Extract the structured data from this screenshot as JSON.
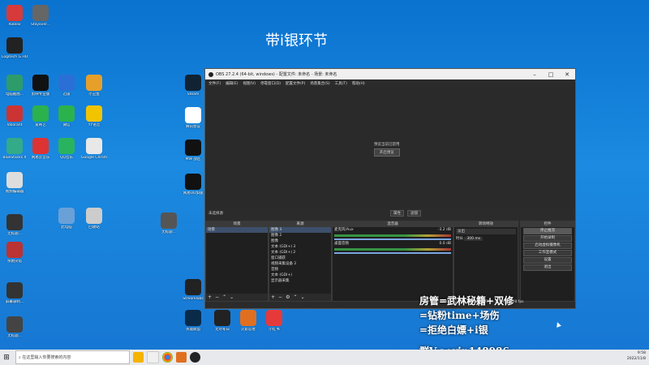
{
  "overlay_title": "带i银环节",
  "desktop_icons": [
    {
      "label": "Roblox",
      "color": "#d63a3a"
    },
    {
      "label": "Stayover...",
      "color": "#666"
    },
    {
      "label": "Logitech G HUB",
      "color": "#222"
    },
    {
      "label": "电脑截图...",
      "color": "#2d9c6a"
    },
    {
      "label": "剪映专业版",
      "color": "#111"
    },
    {
      "label": "迅雷",
      "color": "#2a6fd6"
    },
    {
      "label": "小丑鱼",
      "color": "#e6a02a"
    },
    {
      "label": "Valorant",
      "color": "#c33"
    },
    {
      "label": "爱奇艺",
      "color": "#2bb24c"
    },
    {
      "label": "微信",
      "color": "#2bb24c"
    },
    {
      "label": "YY语音",
      "color": "#f2c400"
    },
    {
      "label": "BlueStacks X",
      "color": "#3a8"
    },
    {
      "label": "网易云音乐",
      "color": "#d33"
    },
    {
      "label": "QQ音乐",
      "color": "#29b35f"
    },
    {
      "label": "Google Chrome",
      "color": "#e8e8e8"
    },
    {
      "label": "视频编辑器",
      "color": "#ddd"
    },
    {
      "label": "此电脑",
      "color": "#6aa0d8"
    },
    {
      "label": "回收站",
      "color": "#ccc"
    },
    {
      "label": "无标题...",
      "color": "#333"
    },
    {
      "label": "杀戮尖塔",
      "color": "#b33"
    },
    {
      "label": "屏幕录制...",
      "color": "#333"
    },
    {
      "label": "无标题...",
      "color": "#444"
    },
    {
      "label": "无标题...",
      "color": "#555"
    },
    {
      "label": "Steam",
      "color": "#123"
    },
    {
      "label": "腾讯会议",
      "color": "#fff"
    },
    {
      "label": "MW 战区",
      "color": "#111"
    },
    {
      "label": "网易UU加速",
      "color": "#111"
    },
    {
      "label": "Streamlabs",
      "color": "#222"
    },
    {
      "label": "英雄联盟",
      "color": "#0a2a4a"
    },
    {
      "label": "无尽冬日",
      "color": "#222"
    },
    {
      "label": "火影忍者",
      "color": "#e07020"
    },
    {
      "label": "小红书",
      "color": "#e63a3a"
    }
  ],
  "obs": {
    "title": "OBS 27.2.4 (64-bit, windows) - 配置文件: 未命名 - 场景: 未命名",
    "menu": [
      "文件(F)",
      "编辑(E)",
      "视图(V)",
      "停靠窗口(D)",
      "配置文件(P)",
      "场景集合(S)",
      "工具(T)",
      "帮助(H)"
    ],
    "preview_msg": "预览当前已禁用",
    "preview_btn": "开启预览",
    "source_bar": {
      "no_source": "未选择源",
      "props": "属性",
      "filters": "滤镜"
    },
    "scenes": {
      "header": "场景",
      "items": [
        "场景"
      ]
    },
    "sources": {
      "header": "来源",
      "items": [
        "图像 3",
        "图像 2",
        "图像",
        "文本 (GDI+) 3",
        "文本 (GDI+) 2",
        "窗口捕获",
        "视频采集设备 2",
        "音频",
        "文本 (GDI+)",
        "显示器采集"
      ]
    },
    "mixer": {
      "header": "混音器",
      "tracks": [
        {
          "name": "麦克风/Aux",
          "db": "-3.2 dB"
        },
        {
          "name": "桌面音频",
          "db": "0.0 dB"
        }
      ]
    },
    "transitions": {
      "header": "转场特效",
      "type": "淡出",
      "duration_label": "时长",
      "duration": "300 ms"
    },
    "controls": {
      "header": "控件",
      "buttons": [
        "停止推流",
        "开始录制",
        "启动虚拟摄像机",
        "工作室模式",
        "设置",
        "退出"
      ]
    },
    "status": "LIVE: 00:00:00  REC: 00:00:00  CPU: 2.0%, 60.00 fps"
  },
  "promo_lines": [
    "房管=武林秘籍+双修",
    "=钻粉time+场伤",
    "=拒绝白嫖+i银",
    "群V:aoyin148986"
  ],
  "taskbar": {
    "search_placeholder": "在这里输入你要搜索的内容",
    "time": "9:58",
    "date": "2022/11/8"
  }
}
